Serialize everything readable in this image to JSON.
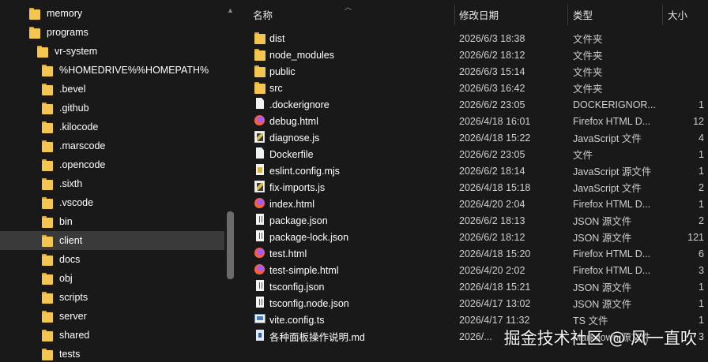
{
  "nav": {
    "items": [
      {
        "label": "memory",
        "indent": 0,
        "selected": false
      },
      {
        "label": "programs",
        "indent": 0,
        "selected": false
      },
      {
        "label": "vr-system",
        "indent": 1,
        "selected": false
      },
      {
        "label": "%HOMEDRIVE%%HOMEPATH%",
        "indent": 2,
        "selected": false
      },
      {
        "label": ".bevel",
        "indent": 2,
        "selected": false
      },
      {
        "label": ".github",
        "indent": 2,
        "selected": false
      },
      {
        "label": ".kilocode",
        "indent": 2,
        "selected": false
      },
      {
        "label": ".marscode",
        "indent": 2,
        "selected": false
      },
      {
        "label": ".opencode",
        "indent": 2,
        "selected": false
      },
      {
        "label": ".sixth",
        "indent": 2,
        "selected": false
      },
      {
        "label": ".vscode",
        "indent": 2,
        "selected": false
      },
      {
        "label": "bin",
        "indent": 2,
        "selected": false
      },
      {
        "label": "client",
        "indent": 2,
        "selected": true
      },
      {
        "label": "docs",
        "indent": 2,
        "selected": false
      },
      {
        "label": "obj",
        "indent": 2,
        "selected": false
      },
      {
        "label": "scripts",
        "indent": 2,
        "selected": false
      },
      {
        "label": "server",
        "indent": 2,
        "selected": false
      },
      {
        "label": "shared",
        "indent": 2,
        "selected": false
      },
      {
        "label": "tests",
        "indent": 2,
        "selected": false
      }
    ]
  },
  "columns": {
    "name": "名称",
    "date": "修改日期",
    "type": "类型",
    "size": "大小"
  },
  "files": [
    {
      "icon": "folder",
      "name": "dist",
      "date": "2026/6/3 18:38",
      "type": "文件夹",
      "size": ""
    },
    {
      "icon": "folder",
      "name": "node_modules",
      "date": "2026/6/2 18:12",
      "type": "文件夹",
      "size": ""
    },
    {
      "icon": "folder",
      "name": "public",
      "date": "2026/6/3 15:14",
      "type": "文件夹",
      "size": ""
    },
    {
      "icon": "folder",
      "name": "src",
      "date": "2026/6/3 16:42",
      "type": "文件夹",
      "size": ""
    },
    {
      "icon": "doc",
      "name": ".dockerignore",
      "date": "2026/6/2 23:05",
      "type": "DOCKERIGNOR...",
      "size": "1"
    },
    {
      "icon": "firefox",
      "name": "debug.html",
      "date": "2026/4/18 16:01",
      "type": "Firefox HTML D...",
      "size": "12"
    },
    {
      "icon": "js",
      "name": "diagnose.js",
      "date": "2026/4/18 15:22",
      "type": "JavaScript 文件",
      "size": "4"
    },
    {
      "icon": "doc",
      "name": "Dockerfile",
      "date": "2026/6/2 23:05",
      "type": "文件",
      "size": "1"
    },
    {
      "icon": "eslint",
      "name": "eslint.config.mjs",
      "date": "2026/6/2 18:14",
      "type": "JavaScript 源文件",
      "size": "1"
    },
    {
      "icon": "js",
      "name": "fix-imports.js",
      "date": "2026/4/18 15:18",
      "type": "JavaScript 文件",
      "size": "2"
    },
    {
      "icon": "firefox",
      "name": "index.html",
      "date": "2026/4/20 2:04",
      "type": "Firefox HTML D...",
      "size": "1"
    },
    {
      "icon": "json",
      "name": "package.json",
      "date": "2026/6/2 18:13",
      "type": "JSON 源文件",
      "size": "2"
    },
    {
      "icon": "json",
      "name": "package-lock.json",
      "date": "2026/6/2 18:12",
      "type": "JSON 源文件",
      "size": "121"
    },
    {
      "icon": "firefox",
      "name": "test.html",
      "date": "2026/4/18 15:20",
      "type": "Firefox HTML D...",
      "size": "6"
    },
    {
      "icon": "firefox",
      "name": "test-simple.html",
      "date": "2026/4/20 2:02",
      "type": "Firefox HTML D...",
      "size": "3"
    },
    {
      "icon": "json",
      "name": "tsconfig.json",
      "date": "2026/4/18 15:21",
      "type": "JSON 源文件",
      "size": "1"
    },
    {
      "icon": "json",
      "name": "tsconfig.node.json",
      "date": "2026/4/17 13:02",
      "type": "JSON 源文件",
      "size": "1"
    },
    {
      "icon": "ts",
      "name": "vite.config.ts",
      "date": "2026/4/17 11:32",
      "type": "TS 文件",
      "size": "1"
    },
    {
      "icon": "md",
      "name": "各种面板操作说明.md",
      "date": "2026/...",
      "type": "Markdown 源文件",
      "size": "3"
    }
  ],
  "watermark": "掘金技术社区 @ 风一直吹",
  "colors": {
    "background": "#191919",
    "selected_row": "#3a3a3a",
    "folder": "#f4c54f",
    "scrollbar_thumb": "#6b6b6b"
  }
}
